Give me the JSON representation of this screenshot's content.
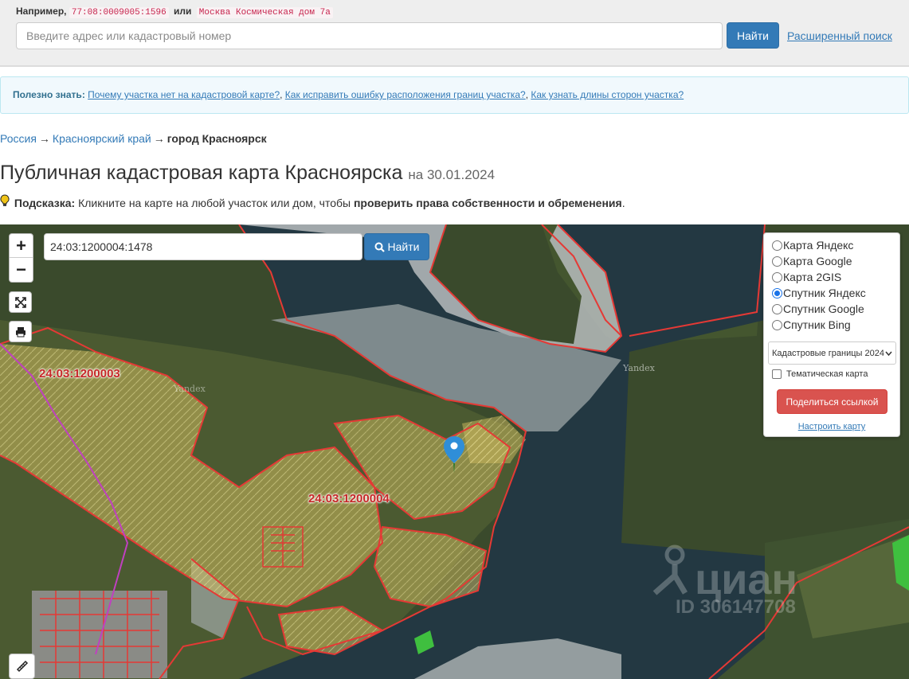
{
  "search": {
    "example_prefix": "Например,",
    "example_cadastral": "77:08:0009005:1596",
    "example_or": "или",
    "example_address": "Москва Космическая дом 7а",
    "placeholder": "Введите адрес или кадастровый номер",
    "find_label": "Найти",
    "advanced_link": "Расширенный поиск"
  },
  "info": {
    "label": "Полезно знать:",
    "links": [
      "Почему участка нет на кадастровой карте?",
      "Как исправить ошибку расположения границ участка?",
      "Как узнать длины сторон участка?"
    ]
  },
  "breadcrumb": {
    "items": [
      "Россия",
      "Красноярский край"
    ],
    "current": "город Красноярск",
    "separator": "→"
  },
  "page": {
    "title": "Публичная кадастровая карта Красноярска",
    "date_prefix": "на",
    "date": "30.01.2024",
    "tip_label": "Подсказка:",
    "tip_text": "Кликните на карте на любой участок или дом, чтобы",
    "tip_bold": "проверить права собственности и обременения",
    "tip_end": "."
  },
  "map": {
    "zoom_in": "+",
    "zoom_out": "−",
    "search_value": "24:03:1200004:1478",
    "find_label": "Найти",
    "labels": [
      "24:03:1200003",
      "24:03:1200004"
    ],
    "provider_tag": "Yandex",
    "watermark_brand": "циан",
    "watermark_id": "ID 306147708",
    "icons": [
      "fullscreen-icon",
      "print-icon",
      "search-icon",
      "location-pin-icon",
      "ruler-icon"
    ],
    "colors": {
      "boundary": "#e53935",
      "parcel_fill": "#d8c46a",
      "accent": "#337ab7",
      "share": "#d9534f"
    }
  },
  "layers": {
    "options": [
      "Карта Яндекс",
      "Карта Google",
      "Карта 2GIS",
      "Спутник Яндекс",
      "Спутник Google",
      "Спутник Bing"
    ],
    "selected": "Спутник Яндекс",
    "overlay_select": "Кадастровые границы 2024",
    "thematic_label": "Тематическая карта",
    "thematic_checked": false,
    "share_label": "Поделиться ссылкой",
    "settings_link": "Настроить карту"
  }
}
